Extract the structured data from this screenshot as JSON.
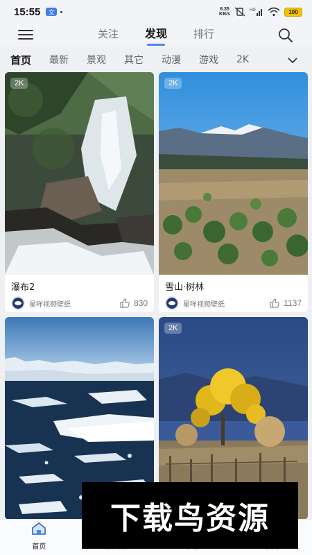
{
  "status_bar": {
    "time": "15:55",
    "app_icon_glyph": "文",
    "net_speed_value": "6.35",
    "net_speed_unit": "KB/s",
    "battery": "100"
  },
  "top_nav": {
    "tabs": [
      {
        "label": "关注",
        "active": false
      },
      {
        "label": "发现",
        "active": true
      },
      {
        "label": "排行",
        "active": false
      }
    ]
  },
  "categories": {
    "items": [
      "首页",
      "最新",
      "景观",
      "其它",
      "动漫",
      "游戏",
      "2K"
    ],
    "active_index": 0
  },
  "cards": [
    {
      "title": "瀑布2",
      "badge": "2K",
      "author": "星咩视频壁纸",
      "likes": "830",
      "image": "waterfall-photo"
    },
    {
      "title": "雪山·树林",
      "badge": "2K",
      "author": "星咩视频壁纸",
      "likes": "1137",
      "image": "snow-mountain-photo"
    },
    {
      "title": "",
      "badge": "",
      "author": "",
      "likes": "",
      "image": "icebergs-photo"
    },
    {
      "title": "",
      "badge": "2K",
      "author": "",
      "likes": "",
      "image": "yellow-tree-photo"
    }
  ],
  "bottom_nav": {
    "tabs": [
      {
        "label": "首页",
        "active": true,
        "icon": "home-icon"
      },
      {
        "label": "播放列表",
        "active": false,
        "icon": "playlist-icon"
      },
      {
        "label": "小组件",
        "active": false,
        "icon": "widget-icon"
      },
      {
        "label": "我的",
        "active": false,
        "icon": "profile-icon"
      }
    ]
  },
  "watermark": {
    "text": "下载鸟资源"
  },
  "colors": {
    "accent": "#4a86f5",
    "background": "#eef0f4"
  }
}
